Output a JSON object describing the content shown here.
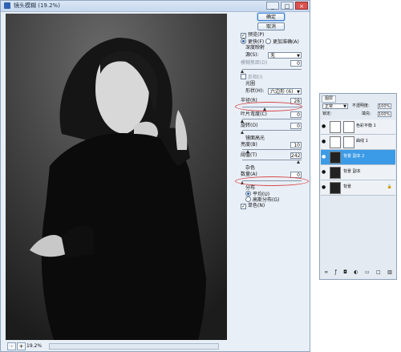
{
  "window": {
    "title": "镜头模糊 (19.2%)",
    "controls": [
      "_",
      "□",
      "×"
    ]
  },
  "status": {
    "zoom_out": "-",
    "zoom_in": "+",
    "zoom_text": "19.2%"
  },
  "panel": {
    "ok_label": "确定",
    "cancel_label": "取消",
    "preview_label": "预览(P)",
    "faster_label": "更快(F)",
    "more_accurate_label": "更加准确(A)",
    "depth_map_label": "深度映射",
    "source_label": "源(S):",
    "source_value": "无",
    "blur_focal_label": "模糊焦距(D)",
    "blur_focal_value": "0",
    "invert_label": "反相(I)",
    "iris_label": "光圈",
    "shape_label": "形状(H):",
    "shape_value": "六边形 (6)",
    "radius_label": "半径(R)",
    "radius_value": "28",
    "blade_label": "叶片弯度(C)",
    "blade_value": "0",
    "rotation_label": "旋转(O)",
    "rotation_value": "0",
    "specular_label": "镜面高光",
    "brightness_label": "亮度(B)",
    "brightness_value": "10",
    "threshold_label": "阈值(T)",
    "threshold_value": "242",
    "noise_label": "杂色",
    "amount_label": "数量(A)",
    "amount_value": "0",
    "distribution_label": "分布",
    "uniform_label": "平均(U)",
    "gaussian_label": "高斯分布(G)",
    "mono_label": "单色(N)"
  },
  "layers": {
    "tab_label": "图层",
    "blend_mode": "正常",
    "opacity_label": "不透明度:",
    "opacity_value": "100%",
    "lock_label": "锁定:",
    "fill_label": "填充:",
    "fill_value": "100%",
    "items": [
      {
        "name": "色彩平衡 1"
      },
      {
        "name": "曲线 1"
      },
      {
        "name": "背景 副本 2"
      },
      {
        "name": "背景 副本"
      },
      {
        "name": "背景"
      }
    ],
    "bottom_icons": [
      "link-icon",
      "fx-icon",
      "mask-icon",
      "adjustment-icon",
      "group-icon",
      "new-layer-icon",
      "trash-icon"
    ]
  },
  "colors": {
    "accent": "#3c9be6",
    "highlight_oval": "#d94a4a",
    "dialog_bg": "#e9eff7"
  }
}
